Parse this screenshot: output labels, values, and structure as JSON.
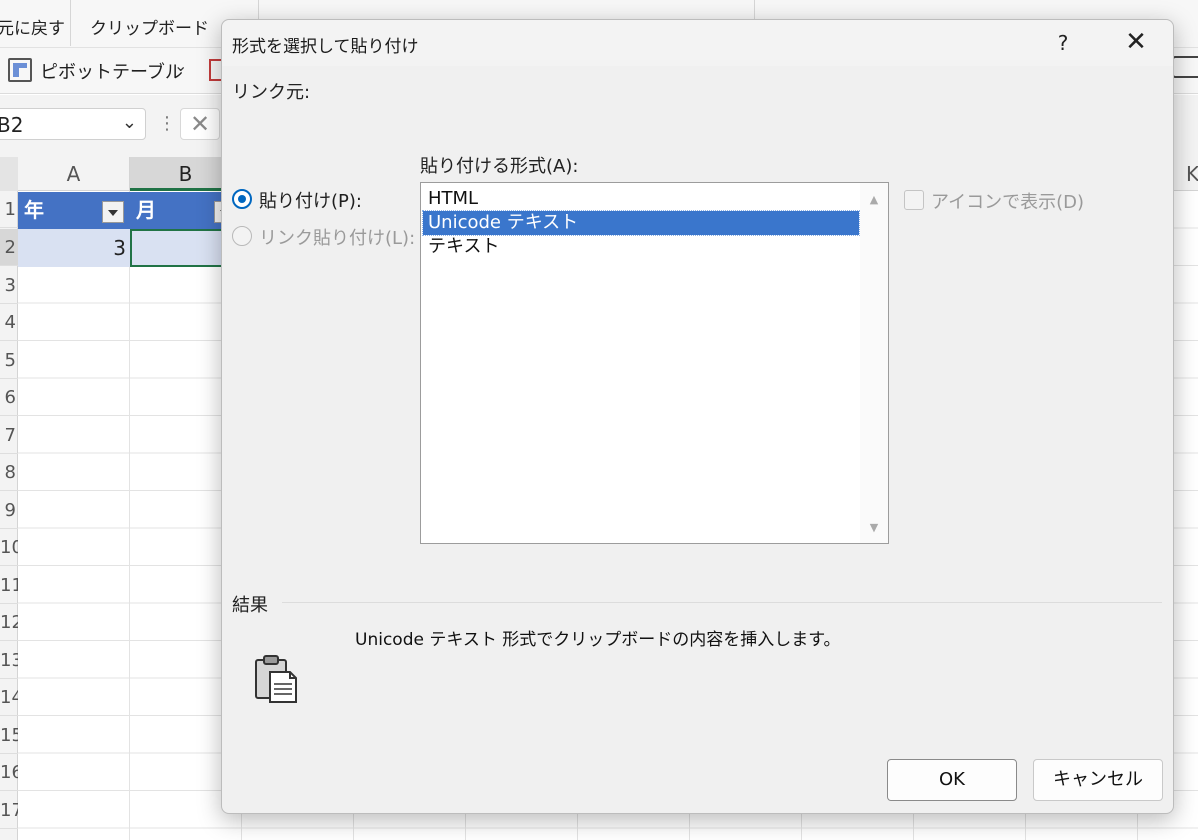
{
  "ribbon": {
    "undo_label": "元に戻す",
    "clipboard_label": "クリップボード",
    "pivot_label": "ピボットテーブル"
  },
  "formula_bar": {
    "name_box_value": "B2"
  },
  "sheet": {
    "columns": [
      "A",
      "B"
    ],
    "right_edge_column": "K",
    "rows": [
      "1",
      "2",
      "3",
      "4",
      "5",
      "6",
      "7",
      "8",
      "9",
      "10",
      "11",
      "12",
      "13",
      "14",
      "15",
      "16",
      "17"
    ],
    "header_cells": [
      "年",
      "月"
    ],
    "cell_a2": "3"
  },
  "dialog": {
    "title": "形式を選択して貼り付け",
    "help_label": "?",
    "close_label": "✕",
    "link_source_label": "リンク元:",
    "paste_radio_label": "貼り付け(P):",
    "paste_link_radio_label": "リンク貼り付け(L):",
    "as_label": "貼り付ける形式(A):",
    "formats": [
      "HTML",
      "Unicode テキスト",
      "テキスト"
    ],
    "selected_format": "Unicode テキスト",
    "display_as_icon_label": "アイコンで表示(D)",
    "result_label": "結果",
    "result_text": "Unicode テキスト 形式でクリップボードの内容を挿入します。",
    "ok_label": "OK",
    "cancel_label": "キャンセル"
  },
  "colors": {
    "accent_blue": "#0067c0",
    "selection_blue": "#3a76cc",
    "table_header_blue": "#4472c4",
    "excel_green": "#217346"
  }
}
